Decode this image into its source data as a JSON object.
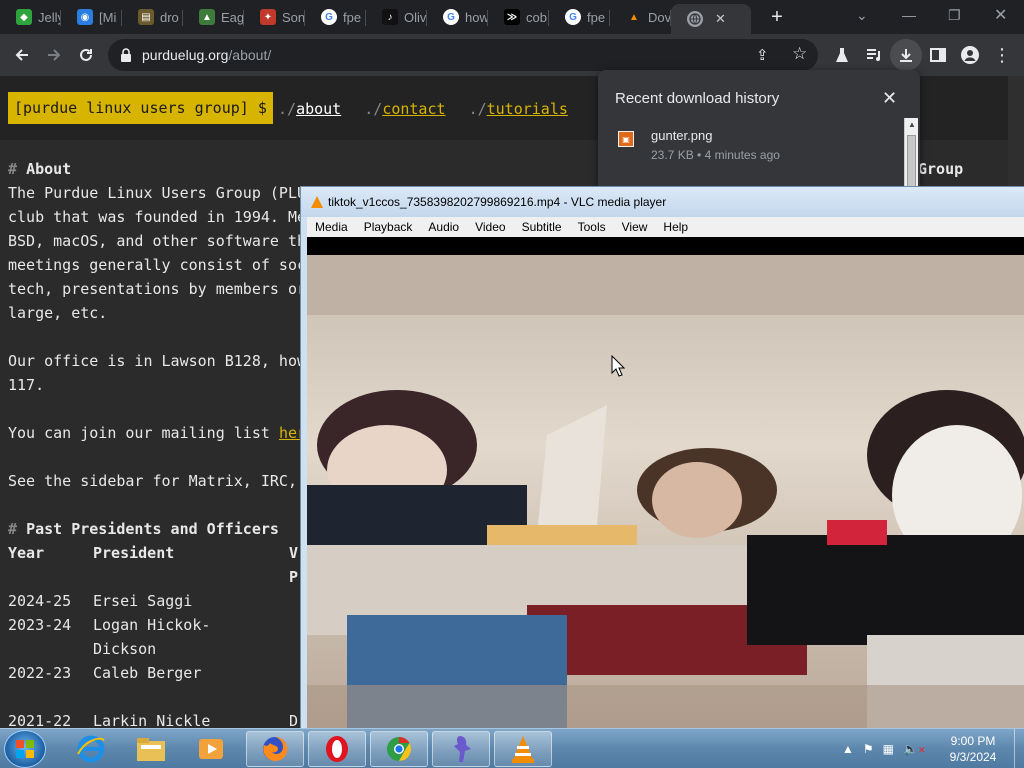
{
  "browser": {
    "tabs": [
      {
        "label": "Jelly",
        "icon": "jellyfin-icon",
        "color": "#2fa33d"
      },
      {
        "label": "[Mi",
        "icon": "matrix-icon",
        "color": "#2a7de1"
      },
      {
        "label": "dro",
        "icon": "folder-icon",
        "color": "#6b5a2c"
      },
      {
        "label": "Eagl",
        "icon": "eagle-icon",
        "color": "#3d7b3a"
      },
      {
        "label": "Son",
        "icon": "son-icon",
        "color": "#c0392b"
      },
      {
        "label": "fpe",
        "icon": "google-icon",
        "color": "#ffffff"
      },
      {
        "label": "Oliv",
        "icon": "tiktok-icon",
        "color": "#111111"
      },
      {
        "label": "how",
        "icon": "google-icon",
        "color": "#ffffff"
      },
      {
        "label": "cob",
        "icon": "terminal-icon",
        "color": "#000000"
      },
      {
        "label": "fpe",
        "icon": "google-icon",
        "color": "#ffffff"
      },
      {
        "label": "Dov",
        "icon": "vlc-icon",
        "color": "#f28c00"
      }
    ],
    "url_host": "purduelug.org",
    "url_path": "/about/"
  },
  "site": {
    "brand": "[purdue linux users group] $",
    "nav_prefix": "./",
    "nav": [
      "about",
      "contact",
      "tutorials"
    ],
    "lines": {
      "about_hash": "#",
      "about_title": "About",
      "p1a": "The Purdue Linux Users Group (PLU",
      "p1b": "club that was founded in 1994. Me",
      "p1c": "BSD, macOS, and other software th",
      "p1d": "meetings generally consist of soc",
      "p1e": "tech, presentations by members or",
      "p1f": "large, etc.",
      "p2a": "Our office is in Lawson B128, how",
      "p2b": "117.",
      "p3": "You can join our mailing list ",
      "p3_link": "her",
      "p4": "See the sidebar for Matrix, IRC,",
      "past_hash": "#",
      "past_title": "Past Presidents and Officers"
    },
    "table": {
      "headers": [
        "Year",
        "President",
        "V",
        "P"
      ],
      "rows": [
        {
          "year": "2024-25",
          "president": "Ersei Saggi"
        },
        {
          "year": "2023-24",
          "president": "Logan Hickok-",
          "president2": "Dickson"
        },
        {
          "year": "2022-23",
          "president": "Caleb Berger"
        },
        {
          "year": "2021-22",
          "president": "Larkin Nickle",
          "extra": "D"
        }
      ]
    },
    "sidebar_heading": "Group"
  },
  "downloads": {
    "title": "Recent download history",
    "file_name": "gunter.png",
    "file_meta": "23.7 KB • 4 minutes ago"
  },
  "vlc": {
    "title": "tiktok_v1ccos_7358398202799869216.mp4 - VLC media player",
    "menu": [
      "Media",
      "Playback",
      "Audio",
      "Video",
      "Subtitle",
      "Tools",
      "View",
      "Help"
    ]
  },
  "taskbar": {
    "time": "9:00 PM",
    "date": "9/3/2024"
  }
}
